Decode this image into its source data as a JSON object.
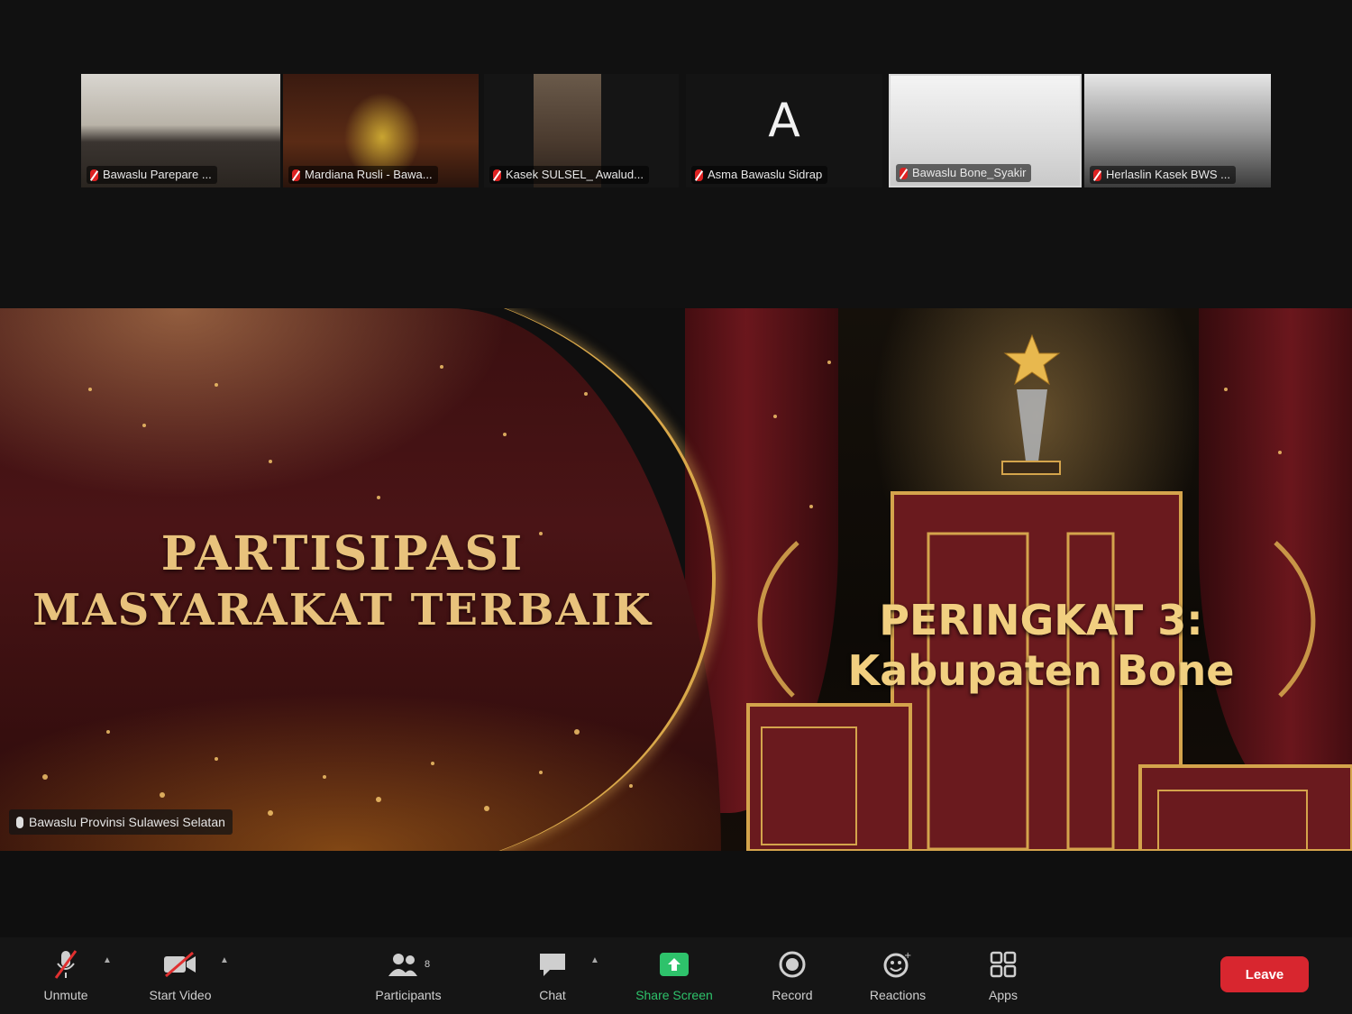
{
  "participants": [
    {
      "name": "Bawaslu Parepare ..."
    },
    {
      "name": "Mardiana Rusli - Bawa..."
    },
    {
      "name": "Kasek SULSEL_ Awalud..."
    },
    {
      "name": "Asma Bawaslu Sidrap",
      "avatar_letter": "A"
    },
    {
      "name": "Bawaslu Bone_Syakir"
    },
    {
      "name": "Herlaslin Kasek BWS ..."
    }
  ],
  "shared_screen": {
    "title_line1": "PARTISIPASI",
    "title_line2": "MASYARAKAT TERBAIK",
    "rank_line1": "PERINGKAT 3:",
    "rank_line2": "Kabupaten Bone",
    "presenter": "Bawaslu Provinsi Sulawesi Selatan"
  },
  "toolbar": {
    "unmute": "Unmute",
    "start_video": "Start Video",
    "participants": "Participants",
    "participant_count": "8",
    "chat": "Chat",
    "share_screen": "Share Screen",
    "record": "Record",
    "reactions": "Reactions",
    "apps": "Apps",
    "leave": "Leave"
  },
  "colors": {
    "share_green": "#2ec26b",
    "leave_red": "#d8262f",
    "gold": "#e8c27c"
  }
}
